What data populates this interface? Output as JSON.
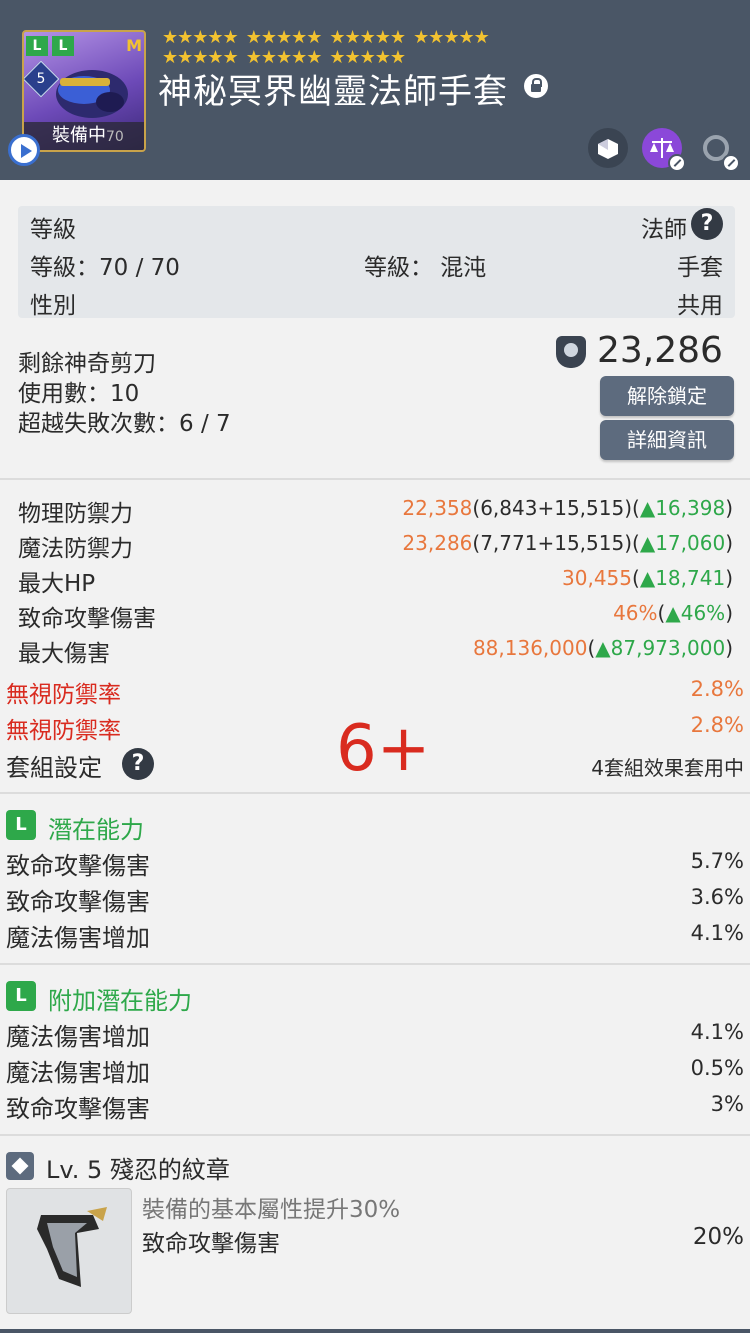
{
  "header": {
    "title": "神秘冥界幽靈法師手套",
    "equip_label": "裝備中",
    "equip_level": "70",
    "badge_l1": "L",
    "badge_l2": "L",
    "badge_m": "M",
    "star_badge": "5",
    "star_rows": [
      [
        "★★★★★",
        "★★★★★",
        "★★★★★",
        "★★★★★"
      ],
      [
        "★★★★★",
        "★★★★★",
        "★★★★★"
      ]
    ],
    "icons": [
      "play-icon",
      "lock-icon",
      "transfer-icon",
      "scale-icon",
      "cycle-icon"
    ]
  },
  "info": {
    "level_label": "等級",
    "job": "法師",
    "level_value": "等級：70 / 70",
    "grade_label": "等級： 混沌",
    "type": "手套",
    "gender_label": "性別",
    "gender": "共用"
  },
  "scissors": {
    "remaining_label": "剩餘神奇剪刀",
    "uses": "使用數：10",
    "fail_count": "超越失敗次數：6 / 7",
    "power": "23,286",
    "unlock_button": "解除鎖定",
    "detail_button": "詳細資訊"
  },
  "stats": [
    {
      "label": "物理防禦力",
      "total": "22,358",
      "detail": "(6,843+15,515)(",
      "arrow": "▲",
      "diff": "16,398",
      "close": ")"
    },
    {
      "label": "魔法防禦力",
      "total": "23,286",
      "detail": "(7,771+15,515)(",
      "arrow": "▲",
      "diff": "17,060",
      "close": ")"
    },
    {
      "label": "最大HP",
      "total": "30,455",
      "detail": "(",
      "arrow": "▲",
      "diff": "18,741",
      "close": ")"
    },
    {
      "label": "致命攻擊傷害",
      "total": "46%",
      "detail": "(",
      "arrow": "▲",
      "diff": "46%",
      "close": ")"
    },
    {
      "label": "最大傷害",
      "total": "88,136,000",
      "detail": "(",
      "arrow": "▲",
      "diff": "87,973,000",
      "close": ")"
    }
  ],
  "ignore_def": [
    {
      "label": "無視防禦率",
      "value": "2.8%"
    },
    {
      "label": "無視防禦率",
      "value": "2.8%"
    }
  ],
  "set": {
    "label": "套組設定",
    "overlay": "6+",
    "status": "4套組效果套用中"
  },
  "potential": {
    "badge": "L",
    "title": "潛在能力",
    "lines": [
      {
        "label": "致命攻擊傷害",
        "value": "5.7%"
      },
      {
        "label": "致命攻擊傷害",
        "value": "3.6%"
      },
      {
        "label": "魔法傷害增加",
        "value": "4.1%"
      }
    ]
  },
  "additional": {
    "badge": "L",
    "title": "附加潛在能力",
    "lines": [
      {
        "label": "魔法傷害增加",
        "value": "4.1%"
      },
      {
        "label": "魔法傷害增加",
        "value": "0.5%"
      },
      {
        "label": "致命攻擊傷害",
        "value": "3%"
      }
    ]
  },
  "emblem": {
    "title": "Lv. 5 殘忍的紋章",
    "desc": "裝備的基本屬性提升30%",
    "stat_label": "致命攻擊傷害",
    "stat_value": "20%"
  },
  "colors": {
    "header": "#4a5666",
    "orange": "#e8773d",
    "green": "#2ea84a",
    "red": "#d92b1f",
    "button": "#5d6b7e"
  }
}
